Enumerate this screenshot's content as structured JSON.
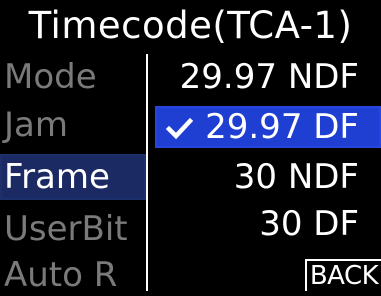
{
  "header": {
    "title": "Timecode(TCA-1)"
  },
  "menu": {
    "items": [
      {
        "label": "Mode"
      },
      {
        "label": "Jam"
      },
      {
        "label": "Frame"
      },
      {
        "label": "UserBit"
      },
      {
        "label": "Auto R"
      }
    ],
    "active_item": "Frame"
  },
  "options": {
    "items": [
      {
        "label": "29.97 NDF"
      },
      {
        "label": "29.97 DF"
      },
      {
        "label": "30 NDF"
      },
      {
        "label": "30 DF"
      }
    ],
    "selected": "29.97 DF",
    "selected_icon": "checkmark-icon"
  },
  "footer": {
    "back_label": "BACK"
  },
  "colors": {
    "background": "#000000",
    "selected_option": "#1f3fd2",
    "active_menu_item": "#1c2a63",
    "dimmed_text": "#7a7a7a",
    "text": "#ffffff"
  }
}
